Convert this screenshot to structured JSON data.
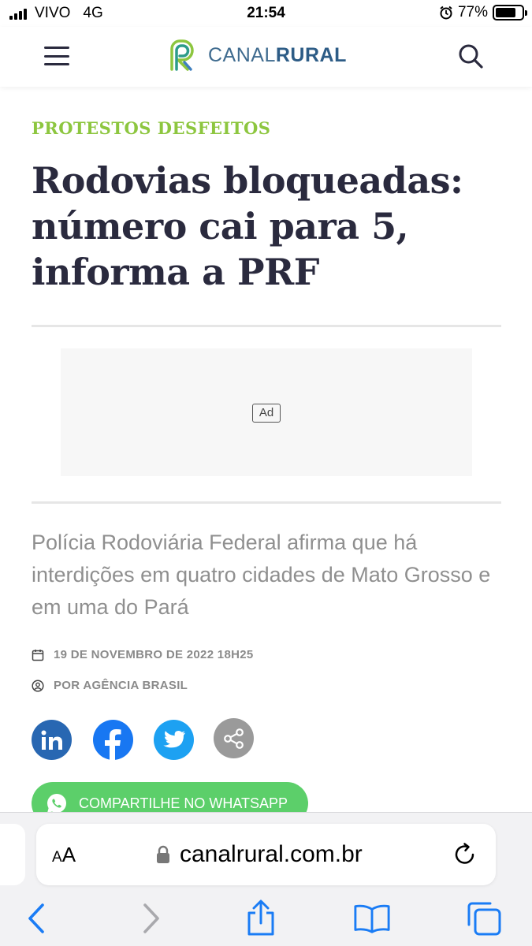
{
  "status_bar": {
    "carrier": "VIVO",
    "network": "4G",
    "time": "21:54",
    "battery": "77%",
    "battery_level": 0.77
  },
  "header": {
    "logo_left": "CANAL",
    "logo_right": "RURAL",
    "menu_icon": "hamburger-icon",
    "search_icon": "search-icon"
  },
  "article": {
    "category": "PROTESTOS DESFEITOS",
    "title": "Rodovias bloqueadas: número cai para 5, informa a PRF",
    "ad_label": "Ad",
    "subtitle": "Polícia Rodoviária Federal afirma que há interdições em quatro cidades de Mato Grosso e em uma do Pará",
    "date": "19 DE NOVEMBRO DE 2022 18H25",
    "author": "POR AGÊNCIA BRASIL",
    "share": {
      "whatsapp_label": "COMPARTILHE NO WHATSAPP",
      "networks": [
        "linkedin",
        "facebook",
        "twitter",
        "share"
      ]
    }
  },
  "browser": {
    "text_size_label_small": "A",
    "text_size_label_large": "A",
    "url": "canalrural.com.br"
  },
  "colors": {
    "category": "#8dc63f",
    "title": "#2a2a3e",
    "linkedin": "#2867b2",
    "facebook": "#1877f2",
    "twitter": "#1da1f2",
    "share_generic": "#9a9a9a",
    "whatsapp": "#5ccf6a",
    "safari_blue": "#1a7cf5"
  }
}
